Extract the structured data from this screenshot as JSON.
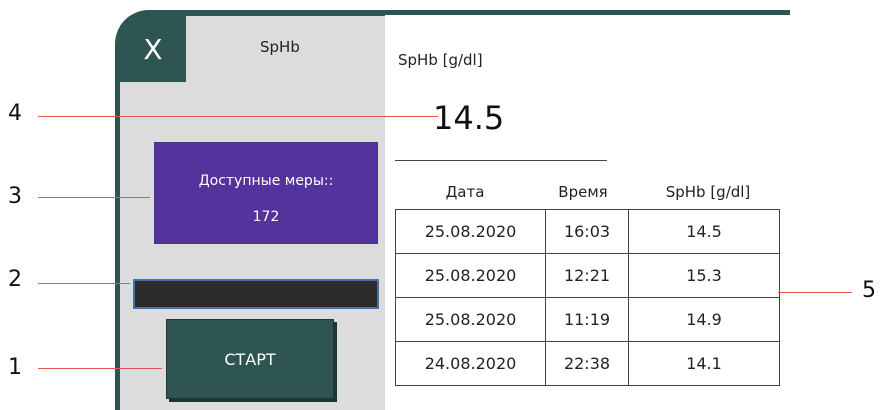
{
  "panel": {
    "close_label": "X",
    "title": "SpHb",
    "measures_label": "Доступные меры::",
    "measures_value": "172",
    "start_label": "СТАРТ"
  },
  "reading": {
    "label": "SpHb [g/dl]",
    "value": "14.5"
  },
  "history": {
    "headers": [
      "Дата",
      "Время",
      "SpHb [g/dl]"
    ],
    "rows": [
      [
        "25.08.2020",
        "16:03",
        "14.5"
      ],
      [
        "25.08.2020",
        "12:21",
        "15.3"
      ],
      [
        "25.08.2020",
        "11:19",
        "14.9"
      ],
      [
        "24.08.2020",
        "22:38",
        "14.1"
      ]
    ]
  },
  "annotations": {
    "n1": "1",
    "n2": "2",
    "n3": "3",
    "n4": "4",
    "n5": "5",
    "line_color": "#e05555"
  },
  "colors": {
    "frame": "#2e5552",
    "measures_bg": "#54339c",
    "progress_bg": "#2b2b2b",
    "panel_bg": "#dcdcdc"
  }
}
